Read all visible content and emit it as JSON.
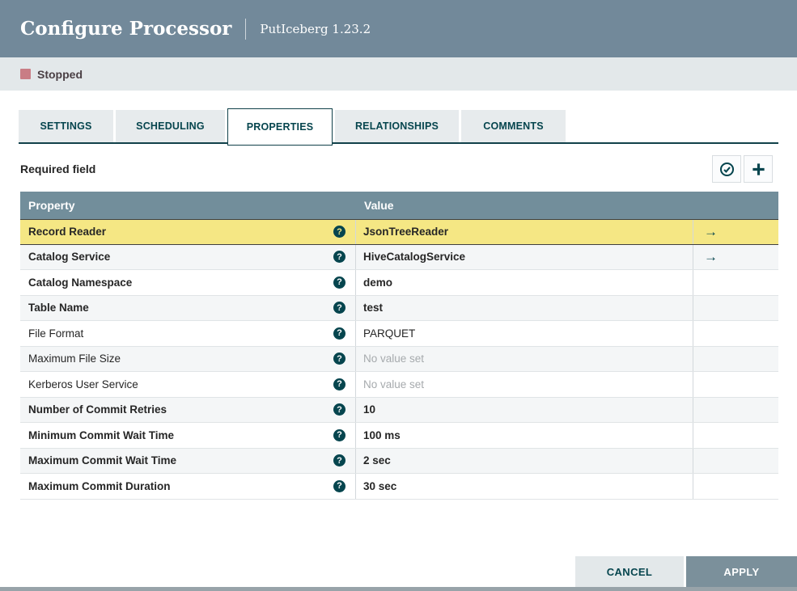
{
  "header": {
    "title": "Configure Processor",
    "subtitle": "PutIceberg 1.23.2"
  },
  "status": {
    "label": "Stopped"
  },
  "tabs": [
    {
      "label": "SETTINGS",
      "active": false
    },
    {
      "label": "SCHEDULING",
      "active": false
    },
    {
      "label": "PROPERTIES",
      "active": true
    },
    {
      "label": "RELATIONSHIPS",
      "active": false
    },
    {
      "label": "COMMENTS",
      "active": false
    }
  ],
  "toolbar": {
    "required_label": "Required field",
    "verify_button_icon": "check-circle-icon",
    "add_button_icon": "plus-icon"
  },
  "table": {
    "columns": [
      "Property",
      "Value"
    ],
    "rows": [
      {
        "property": "Record Reader",
        "required": true,
        "value": "JsonTreeReader",
        "empty": false,
        "has_goto_arrow": true,
        "selected": true
      },
      {
        "property": "Catalog Service",
        "required": true,
        "value": "HiveCatalogService",
        "empty": false,
        "has_goto_arrow": true,
        "selected": false
      },
      {
        "property": "Catalog Namespace",
        "required": true,
        "value": "demo",
        "empty": false,
        "has_goto_arrow": false,
        "selected": false
      },
      {
        "property": "Table Name",
        "required": true,
        "value": "test",
        "empty": false,
        "has_goto_arrow": false,
        "selected": false
      },
      {
        "property": "File Format",
        "required": false,
        "value": "PARQUET",
        "empty": false,
        "has_goto_arrow": false,
        "selected": false
      },
      {
        "property": "Maximum File Size",
        "required": false,
        "value": "No value set",
        "empty": true,
        "has_goto_arrow": false,
        "selected": false
      },
      {
        "property": "Kerberos User Service",
        "required": false,
        "value": "No value set",
        "empty": true,
        "has_goto_arrow": false,
        "selected": false
      },
      {
        "property": "Number of Commit Retries",
        "required": true,
        "value": "10",
        "empty": false,
        "has_goto_arrow": false,
        "selected": false
      },
      {
        "property": "Minimum Commit Wait Time",
        "required": true,
        "value": "100 ms",
        "empty": false,
        "has_goto_arrow": false,
        "selected": false
      },
      {
        "property": "Maximum Commit Wait Time",
        "required": true,
        "value": "2 sec",
        "empty": false,
        "has_goto_arrow": false,
        "selected": false
      },
      {
        "property": "Maximum Commit Duration",
        "required": true,
        "value": "30 sec",
        "empty": false,
        "has_goto_arrow": false,
        "selected": false
      }
    ]
  },
  "icons": {
    "help_glyph": "?",
    "goto_arrow_glyph": "→"
  },
  "footer": {
    "cancel_label": "CANCEL",
    "apply_label": "APPLY"
  },
  "colors": {
    "header_bg": "#72899a",
    "status_bar_bg": "#e3e8ea",
    "stopped_square": "#c97d85",
    "accent_teal": "#06454e",
    "table_header_bg": "#728e9b",
    "selected_row_bg": "#f5e784",
    "alt_row_bg": "#f4f6f7",
    "cancel_button_bg": "#e3e8ea",
    "apply_button_bg": "#7b909b"
  }
}
